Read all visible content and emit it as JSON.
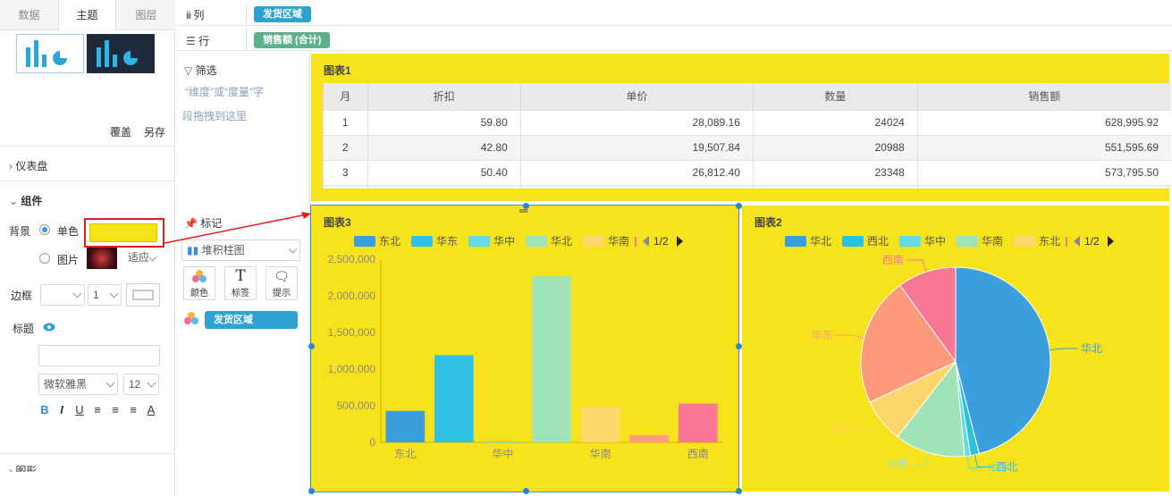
{
  "left_panel": {
    "tabs": [
      "数据",
      "主题",
      "图层"
    ],
    "active_tab": "主题",
    "actions": {
      "overwrite": "覆盖",
      "save_as": "另存"
    },
    "dashboard_label": "仪表盘",
    "component_label": "组件",
    "background": {
      "label": "背景",
      "single_label": "单色",
      "image_label": "图片",
      "fit_value": "适应",
      "color": "#f7e31b"
    },
    "border": {
      "label": "边框",
      "width_value": "1"
    },
    "title": {
      "label": "标题",
      "font_value": "微软雅黑",
      "size_value": "12"
    },
    "format_buttons": [
      "B",
      "I",
      "U"
    ],
    "bottom_section": "图形"
  },
  "shelves": {
    "columns_label": "列",
    "columns_pill": "发货区域",
    "rows_label": "行",
    "rows_pill": "销售额 (合计)"
  },
  "filter": {
    "label": "筛选",
    "hint_line1": "“维度”或“度量”字",
    "hint_line2": "段拖拽到这里"
  },
  "marks": {
    "label": "标记",
    "chart_type": "堆积柱图",
    "buttons": [
      "颜色",
      "标签",
      "提示"
    ],
    "color_field": "发货区域"
  },
  "panels": {
    "table": {
      "title": "图表1",
      "headers": [
        "月",
        "折扣",
        "单价",
        "数量",
        "销售额"
      ],
      "rows": [
        [
          "1",
          "59.80",
          "28,089.16",
          "24024",
          "628,995.92"
        ],
        [
          "2",
          "42.80",
          "19,507.84",
          "20988",
          "551,595.69"
        ],
        [
          "3",
          "50.40",
          "26,812.40",
          "23348",
          "573,795.50"
        ]
      ]
    },
    "bar": {
      "title": "图表3",
      "legend": [
        "东北",
        "华东",
        "华中",
        "华北",
        "华南"
      ],
      "page": "1/2"
    },
    "pie": {
      "title": "图表2",
      "legend": [
        "华北",
        "西北",
        "华中",
        "华南",
        "东北"
      ],
      "page": "1/2"
    }
  },
  "colors": {
    "accent_yellow": "#f7e31b",
    "pill_blue": "#2ea3cf",
    "pill_green": "#5cb08a",
    "highlight_red": "#e21f1f"
  },
  "chart_data": [
    {
      "type": "bar",
      "categories": [
        "东北",
        "华东",
        "华中",
        "华北",
        "华南",
        "西北",
        "西南"
      ],
      "values": [
        430000,
        1190000,
        10000,
        2270000,
        490000,
        100000,
        530000
      ],
      "colors": [
        "#3a9fdc",
        "#33c0e6",
        "#66dbe4",
        "#a0e3b8",
        "#fdd76b",
        "#fe9a80",
        "#f87795"
      ],
      "tick_labels": [
        "东北",
        "华中",
        "华南",
        "西南"
      ],
      "yticks": [
        "0",
        "500,000",
        "1,000,000",
        "1,500,000",
        "2,000,000",
        "2,500,000"
      ],
      "ylim": [
        0,
        2500000
      ],
      "grid": false
    },
    {
      "type": "pie",
      "slices": [
        {
          "label": "华北",
          "value": 46.0,
          "color": "#3a9fdc"
        },
        {
          "label": "西北",
          "value": 1.5,
          "color": "#2ac0df"
        },
        {
          "label": "华中",
          "value": 1.0,
          "color": "#66dbe4"
        },
        {
          "label": "华南",
          "value": 12.0,
          "color": "#9fe3b9"
        },
        {
          "label": "东北",
          "value": 7.5,
          "color": "#fdd76b"
        },
        {
          "label": "华东",
          "value": 22.0,
          "color": "#fe9a7c"
        },
        {
          "label": "西南",
          "value": 10.0,
          "color": "#f87795"
        }
      ]
    }
  ]
}
